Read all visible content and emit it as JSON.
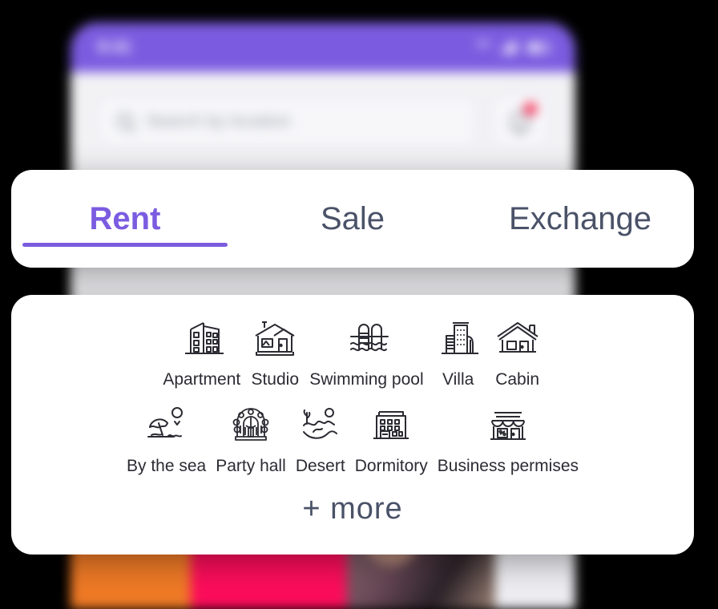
{
  "phone": {
    "status_bar": {
      "clock": "9:41",
      "icons": [
        "wifi-icon",
        "cellular-signal-icon",
        "battery-icon"
      ],
      "background_color": "#7b5ce0"
    },
    "search": {
      "icon": "search-icon",
      "placeholder": "Search by location",
      "value": ""
    },
    "notifications": {
      "icon": "bell-icon",
      "badge": true,
      "badge_color": "#f8214a"
    }
  },
  "tab_bar": {
    "accent_color": "#7b5ce0",
    "inactive_color": "#4a5268",
    "active_index": 0,
    "tabs": [
      {
        "label": "Rent",
        "active": true
      },
      {
        "label": "Sale",
        "active": false
      },
      {
        "label": "Exchange",
        "active": false
      }
    ]
  },
  "categories": {
    "row1": [
      {
        "label": "Apartment",
        "icon": "apartment-building-icon"
      },
      {
        "label": "Studio",
        "icon": "studio-house-icon"
      },
      {
        "label": "Swimming pool",
        "icon": "swimming-pool-icon"
      },
      {
        "label": "Villa",
        "icon": "villa-tower-icon"
      },
      {
        "label": "Cabin",
        "icon": "cabin-house-icon"
      }
    ],
    "row2": [
      {
        "label": "By the sea",
        "icon": "beach-parasol-icon"
      },
      {
        "label": "Party hall",
        "icon": "party-hall-icon"
      },
      {
        "label": "Desert",
        "icon": "desert-dunes-icon"
      },
      {
        "label": "Dormitory",
        "icon": "dormitory-building-icon"
      },
      {
        "label": "Business permises",
        "icon": "storefront-icon"
      }
    ],
    "more_label": "+ more",
    "label_color": "#2b2b33"
  }
}
